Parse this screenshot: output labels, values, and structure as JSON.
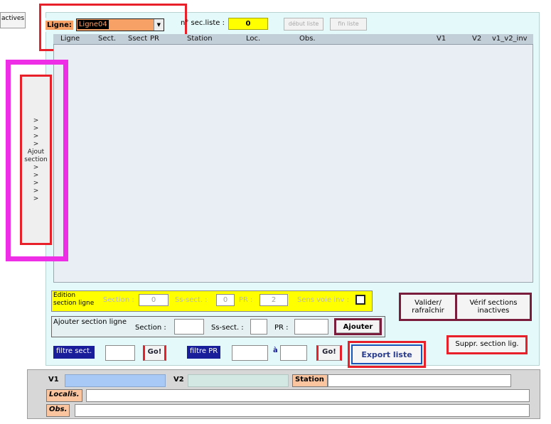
{
  "tab": {
    "label": "actives"
  },
  "top": {
    "ligne_label": "Ligne:",
    "ligne_value": "Ligne04",
    "n_sec_label": "n° sec.liste :",
    "n_sec_value": "0",
    "debut_label": "début liste",
    "fin_label": "fin liste"
  },
  "list": {
    "columns": [
      "Ligne",
      "Sect.",
      "Ssect",
      "PR",
      "Station",
      "Loc.",
      "Obs.",
      "V1",
      "V2",
      "v1_v2_inv"
    ]
  },
  "side_button": {
    "lines": [
      ">",
      ">",
      ">",
      ">",
      "Ajout",
      "section",
      ">",
      ">",
      ">",
      ">",
      ">"
    ]
  },
  "edition": {
    "title_line1": "Edition",
    "title_line2": "section ligne",
    "section_label": "Section :",
    "section_value": "0",
    "ss_sect_label": "Ss-sect. :",
    "ss_sect_value": "0",
    "pr_label": "PR :",
    "pr_value": "2",
    "sens_label": "Sens voie inv :"
  },
  "ajouter": {
    "title": "Ajouter section ligne",
    "section_label": "Section :",
    "ss_sect_label": "Ss-sect. :",
    "pr_label": "PR :",
    "button": "Ajouter"
  },
  "buttons": {
    "valider_line1": "Valider/",
    "valider_line2": "rafraîchir",
    "verif_line1": "Vérif sections",
    "verif_line2": "inactives",
    "suppr": "Suppr. section lig.",
    "export": "Export liste"
  },
  "filters": {
    "sect_label": "filtre sect.",
    "go1": "Go!",
    "pr_label": "filtre PR",
    "a_label": "à",
    "go2": "Go!"
  },
  "bottom": {
    "v1_label": "V1",
    "v2_label": "V2",
    "station_label": "Station",
    "localis_label": "Localis.",
    "obs_label": "Obs."
  },
  "colors": {
    "accent_red": "#e8202a",
    "magenta": "#ee2ee6",
    "yellow": "#ffff00",
    "orange_combo": "#f7a167",
    "blue_filter": "#1a1d9a"
  }
}
